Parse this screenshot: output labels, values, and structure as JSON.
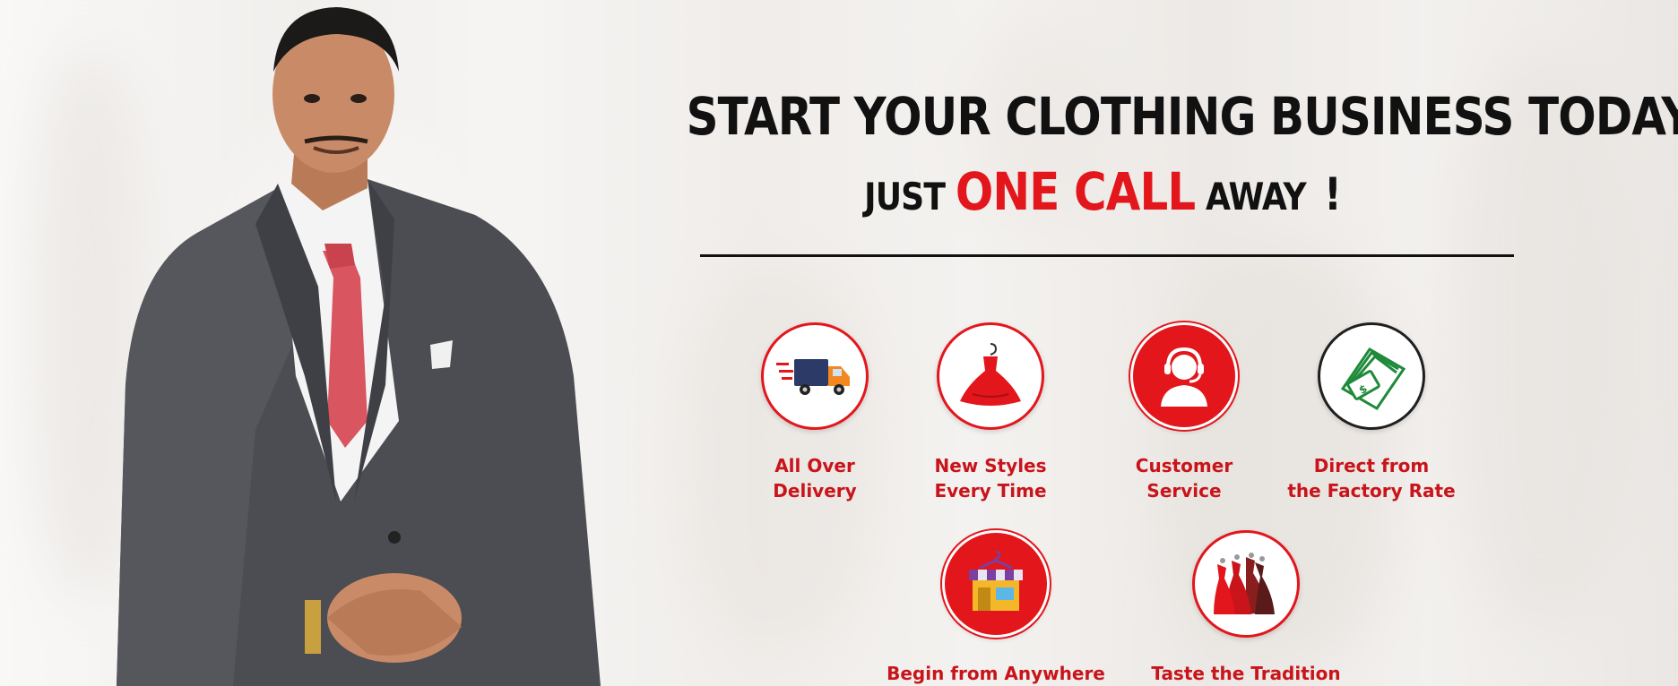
{
  "headline": {
    "line1": "START YOUR CLOTHING BUSINESS TODAY",
    "line2_before": "JUST",
    "line2_accent": "ONE CALL",
    "line2_after": "AWAY",
    "line2_bang": "!"
  },
  "features": [
    {
      "line1": "All Over",
      "line2": "Delivery",
      "icon": "delivery-truck-icon"
    },
    {
      "line1": "New Styles",
      "line2": "Every Time",
      "icon": "dress-on-hanger-icon"
    },
    {
      "line1": "Customer",
      "line2": "Service",
      "icon": "headset-support-icon"
    },
    {
      "line1": "Direct from",
      "line2": "the Factory Rate",
      "icon": "money-bills-icon"
    },
    {
      "line1": "Begin from Anywhere",
      "line2": "",
      "icon": "storefront-icon"
    },
    {
      "line1": "Taste the Tradition",
      "line2": "",
      "icon": "traditional-dresses-icon"
    }
  ],
  "colors": {
    "accent": "#e3161c",
    "text": "#111111",
    "label": "#c8141a",
    "money": "#1f8a3a"
  }
}
